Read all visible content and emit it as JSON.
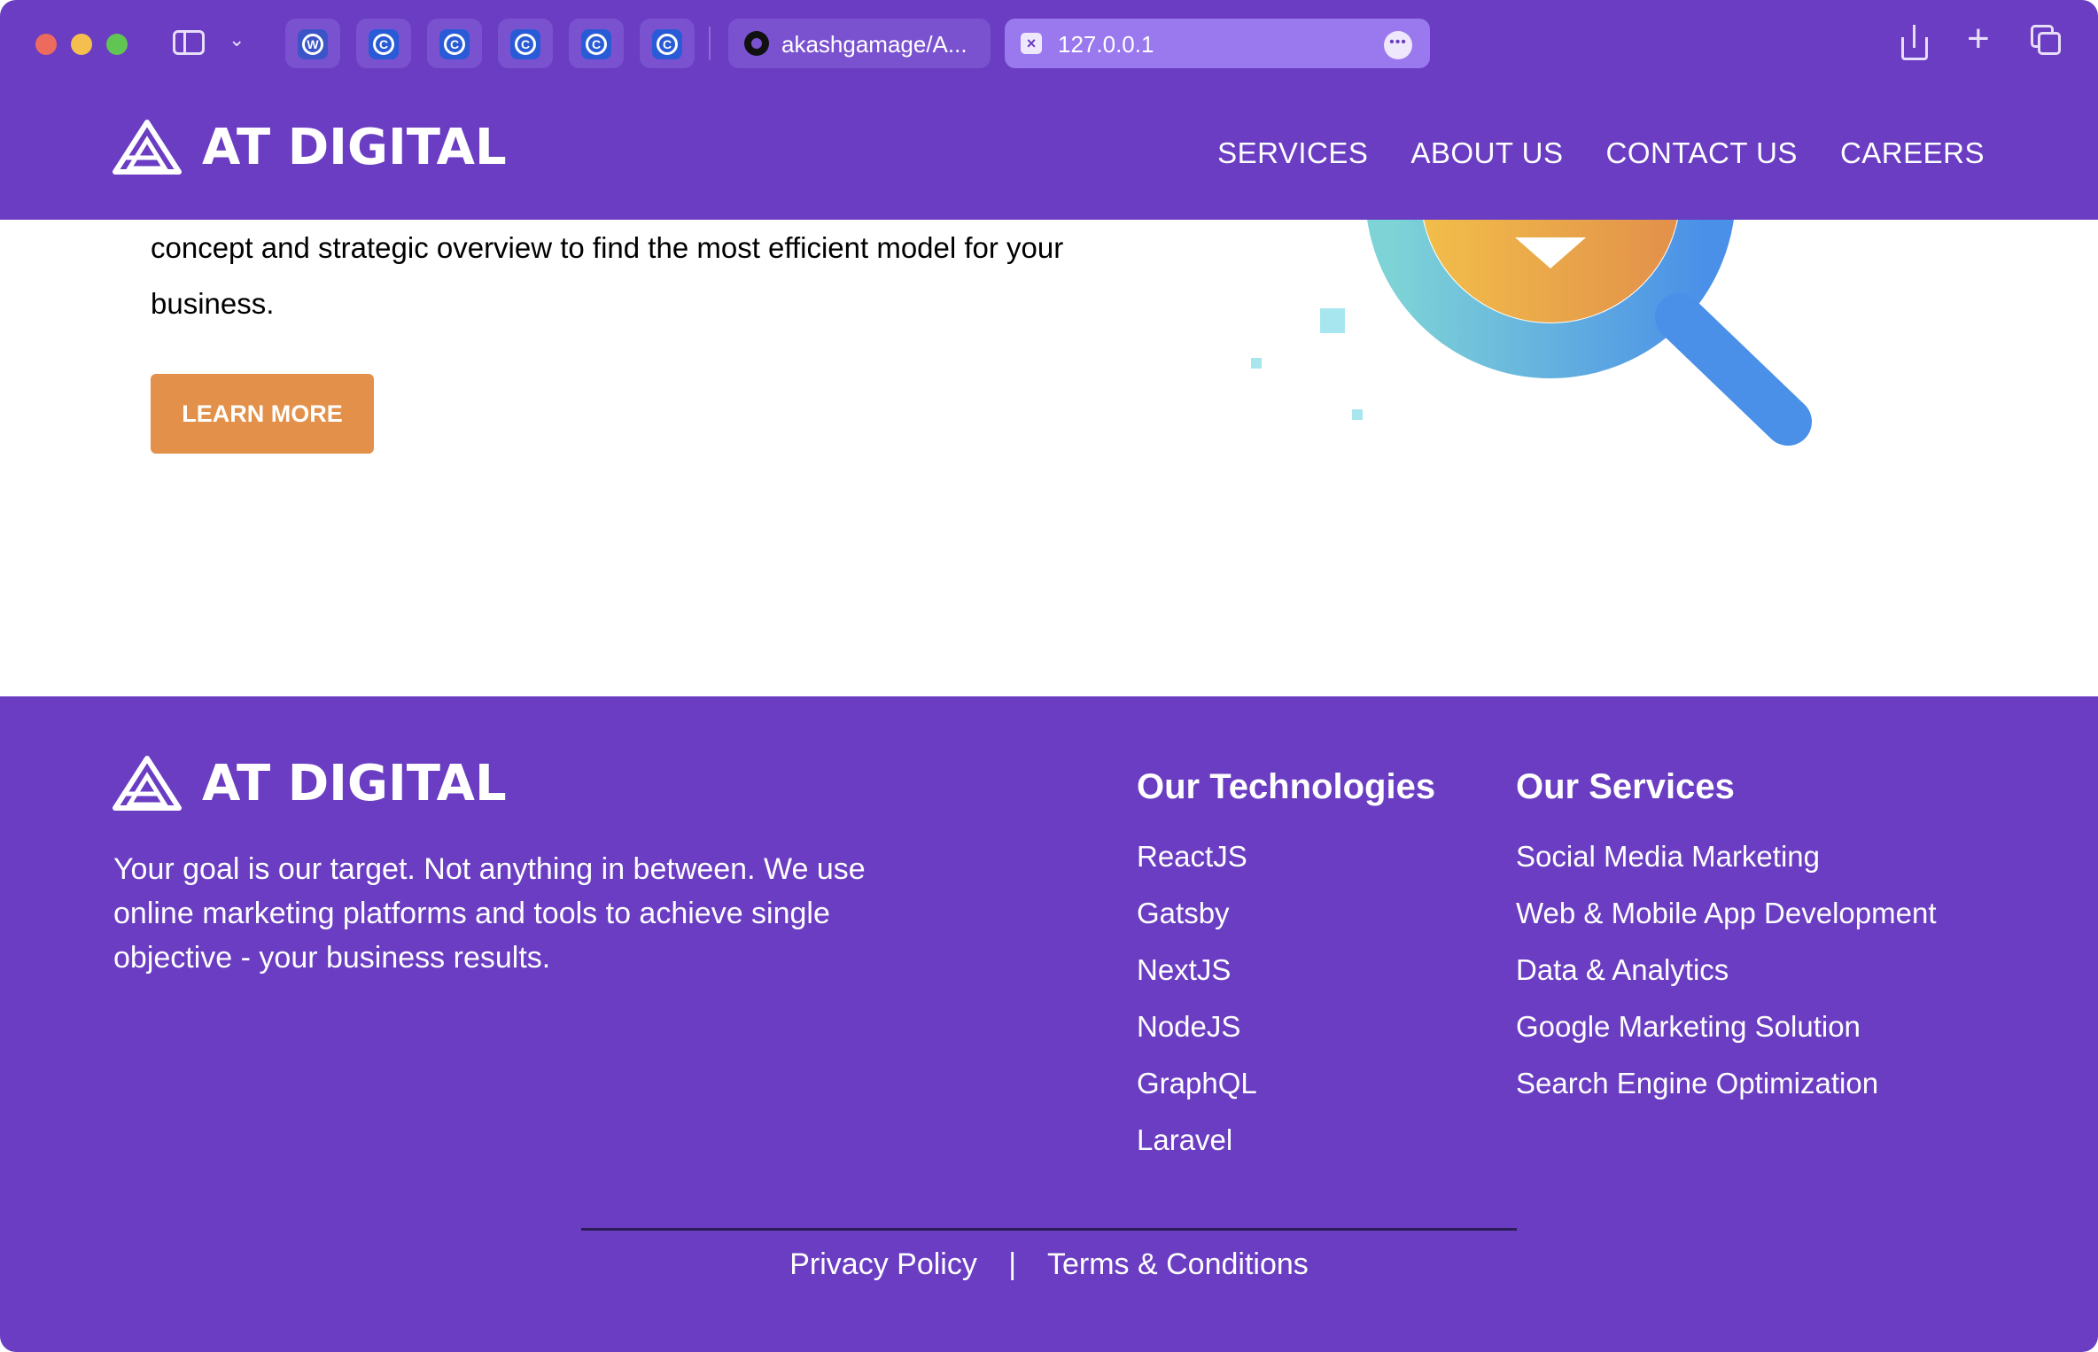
{
  "browser": {
    "github_tab_label": "akashgamage/A...",
    "active_tab_label": "127.0.0.1",
    "pinned_tabs": [
      {
        "icon": "wordpress-icon"
      },
      {
        "icon": "c-app-icon"
      },
      {
        "icon": "c-app-icon"
      },
      {
        "icon": "c-app-icon"
      },
      {
        "icon": "c-app-icon"
      },
      {
        "icon": "c-app-icon"
      }
    ]
  },
  "header": {
    "logo_text": "AT DIGITAL",
    "nav": [
      "SERVICES",
      "ABOUT US",
      "CONTACT US",
      "CAREERS"
    ]
  },
  "hero": {
    "line1": "concept and strategic overview to find the most efficient model for your",
    "line2": "business.",
    "button_label": "LEARN MORE"
  },
  "footer": {
    "logo_text": "AT DIGITAL",
    "tagline_lines": [
      "Your goal is our target. Not anything in between. We use",
      "online marketing platforms and tools to achieve single",
      "objective - your business results."
    ],
    "technologies_title": "Our Technologies",
    "technologies": [
      "ReactJS",
      "Gatsby",
      "NextJS",
      "NodeJS",
      "GraphQL",
      "Laravel"
    ],
    "services_title": "Our Services",
    "services": [
      "Social Media Marketing",
      "Web & Mobile App Development",
      "Data & Analytics",
      "Google Marketing Solution",
      "Search Engine Optimization"
    ],
    "privacy": "Privacy Policy",
    "separator": "|",
    "terms": "Terms & Conditions"
  },
  "colors": {
    "brand_purple": "#6a3dc2",
    "button_orange": "#e3914a",
    "active_tab": "#9a78ee"
  }
}
